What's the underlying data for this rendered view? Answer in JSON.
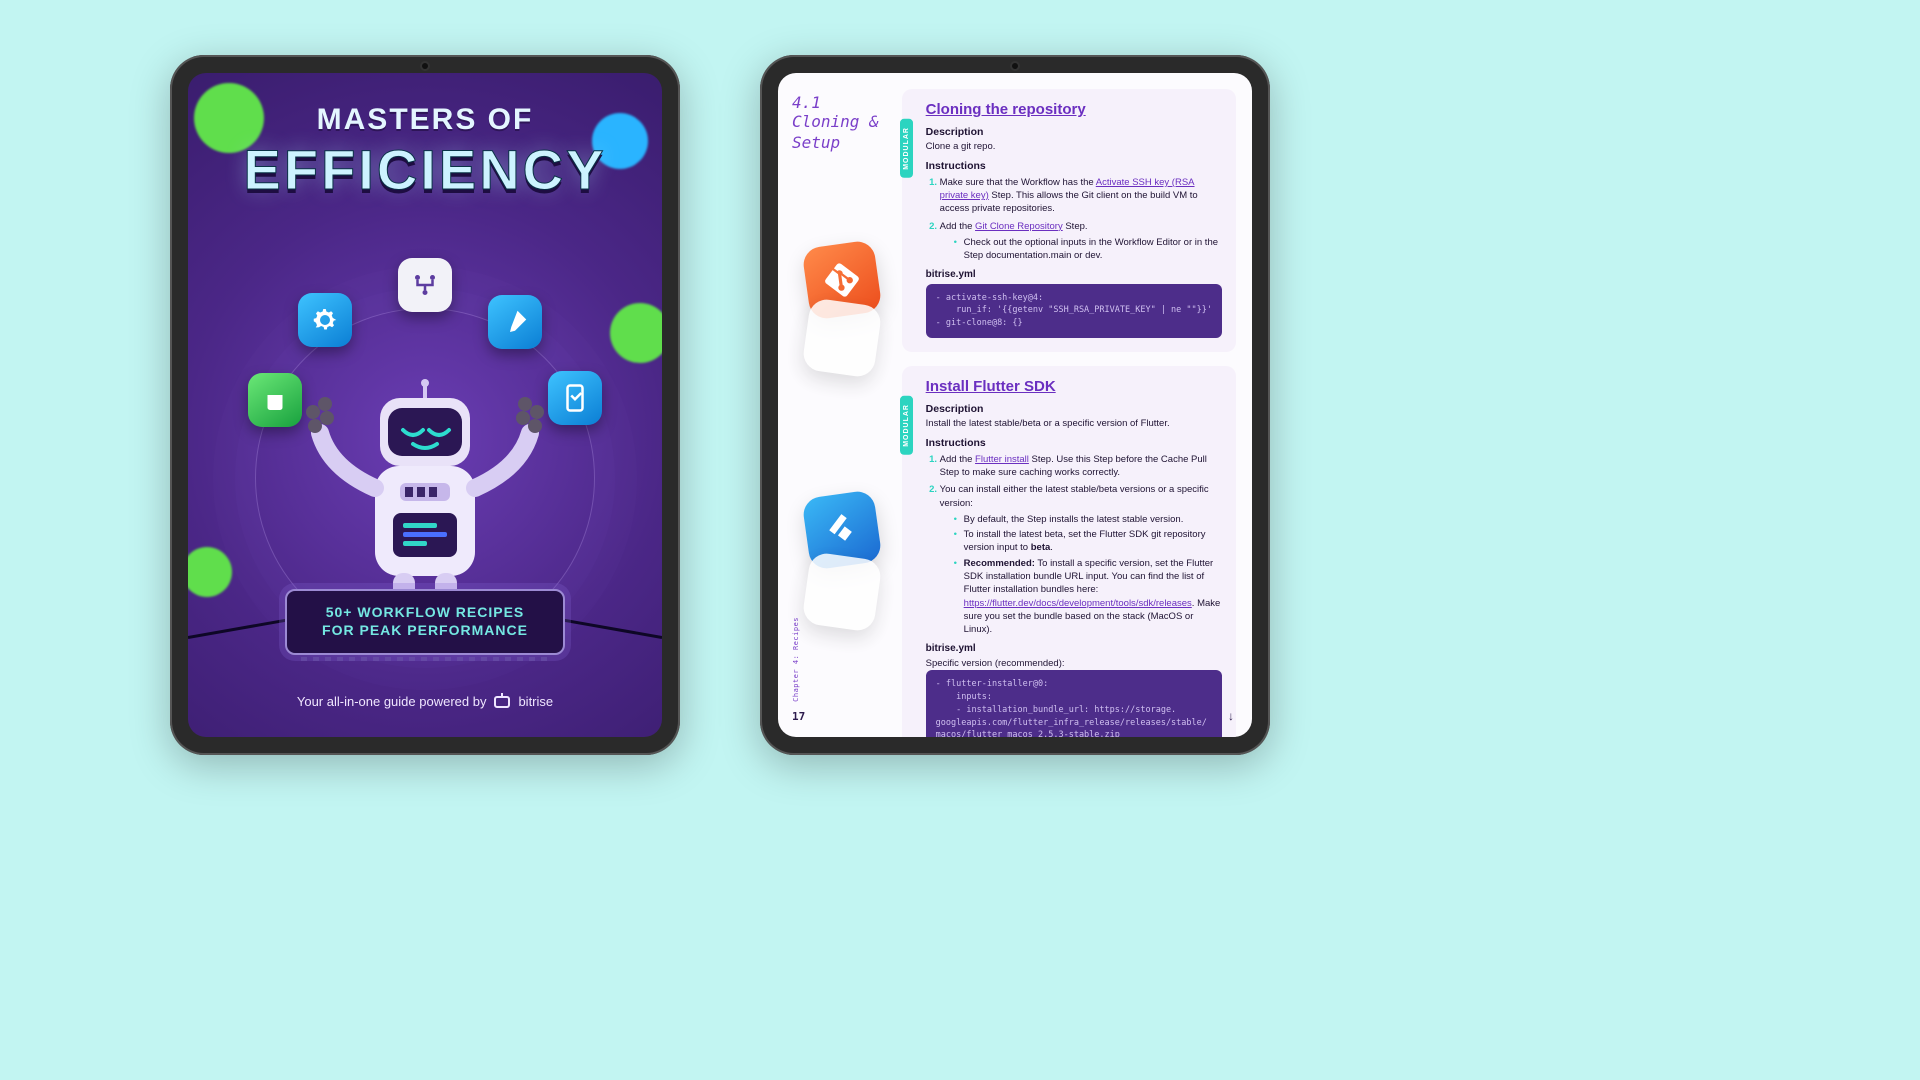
{
  "cover": {
    "title_line1": "MASTERS OF",
    "title_line2": "EFFICIENCY",
    "banner_line1": "50+ WORKFLOW RECIPES",
    "banner_line2": "FOR PEAK PERFORMANCE",
    "powered_by": "Your all-in-one guide powered by",
    "brand": "bitrise"
  },
  "page": {
    "section_number": "4.1",
    "section_name": "Cloning & Setup",
    "chapter_label": "Chapter 4: Recipes",
    "page_number": "17",
    "tag": "MODULAR",
    "sections": [
      {
        "heading": "Cloning the repository",
        "desc_h": "Description",
        "desc": "Clone a git repo.",
        "inst_h": "Instructions",
        "step1_a": "Make sure that the Workflow has the ",
        "step1_link": "Activate SSH key (RSA private key)",
        "step1_b": " Step. This allows the Git client on the build VM to access private repositories.",
        "step2_a": "Add the ",
        "step2_link": "Git Clone Repository",
        "step2_b": " Step.",
        "step2_sub": "Check out the optional inputs in the Workflow Editor or in the Step documentation.main or dev.",
        "yml_h": "bitrise.yml",
        "code": "- activate-ssh-key@4:\n    run_if: '{{getenv \"SSH_RSA_PRIVATE_KEY\" | ne \"\"}}'\n- git-clone@8: {}"
      },
      {
        "heading": "Install Flutter SDK",
        "desc_h": "Description",
        "desc": "Install the latest stable/beta or a specific version of Flutter.",
        "inst_h": "Instructions",
        "s1_a": "Add the ",
        "s1_link": "Flutter install",
        "s1_b": " Step. Use this Step before the Cache Pull Step to make sure caching works correctly.",
        "s2": "You can install either the latest stable/beta versions or a specific version:",
        "s2_b1": "By default, the Step installs the latest stable version.",
        "s2_b2_a": "To install the latest beta, set the Flutter SDK git repository version input to ",
        "s2_b2_bold": "beta",
        "s2_b3_bold": "Recommended:",
        "s2_b3_a": " To install a specific version, set the Flutter SDK installation bundle URL input. You can find the list of Flutter installation bundles here: ",
        "s2_b3_link": "https://flutter.dev/docs/development/tools/sdk/releases",
        "s2_b3_b": ". Make sure you set the bundle based on the stack (MacOS or Linux).",
        "yml_h": "bitrise.yml",
        "yml_note": "Specific version (recommended):",
        "code": "- flutter-installer@0:\n    inputs:\n    - installation_bundle_url: https://storage.\ngoogleapis.com/flutter_infra_release/releases/stable/\nmacos/flutter_macos_2.5.3-stable.zip"
      }
    ]
  }
}
